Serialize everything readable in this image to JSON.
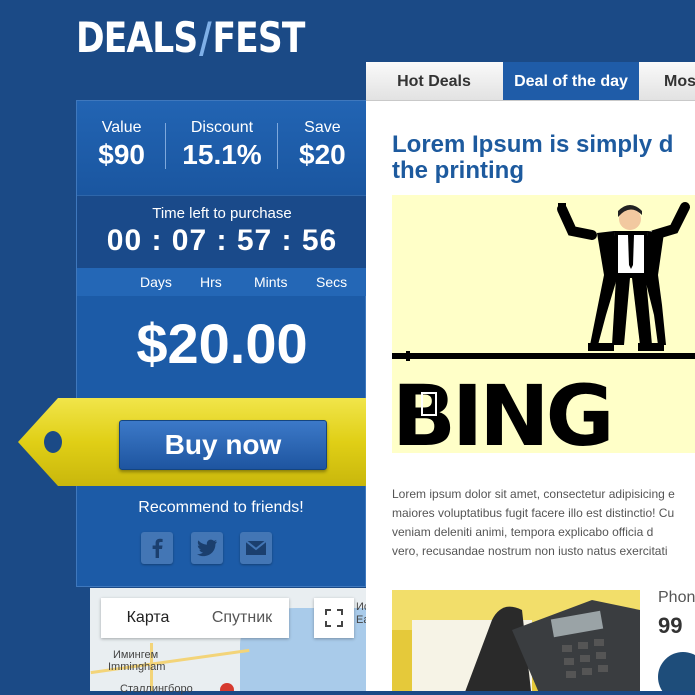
{
  "logo": {
    "part1": "DEALS",
    "slash": "/",
    "part2": "FEST"
  },
  "deal_stats": [
    {
      "label": "Value",
      "value": "$90"
    },
    {
      "label": "Discount",
      "value": "15.1%"
    },
    {
      "label": "Save",
      "value": "$20"
    }
  ],
  "timer": {
    "title": "Time left to purchase",
    "digits": "00 : 07 : 57 : 56",
    "units": [
      "Days",
      "Hrs",
      "Mints",
      "Secs"
    ]
  },
  "price": "$20.00",
  "buy_label": "Buy now",
  "recommend_text": "Recommend to friends!",
  "social": [
    "facebook-icon",
    "twitter-icon",
    "mail-icon"
  ],
  "map": {
    "tab_map": "Карта",
    "tab_satellite": "Спутник",
    "place1": "Имингем",
    "place2": "Immingham",
    "place3": "Сталлингборо",
    "edge1": "Ис",
    "edge2": "Ea"
  },
  "tabs": [
    {
      "label": "Hot Deals"
    },
    {
      "label": "Deal of the day",
      "active": true
    },
    {
      "label": "Mos"
    }
  ],
  "article": {
    "heading_line1": "Lorem Ipsum is simply d",
    "heading_line2": "the printing",
    "bingo_text": "BING",
    "paragraph": [
      "Lorem ipsum dolor sit amet, consectetur adipisicing e",
      "maiores voluptatibus fugit facere illo est distinctio! Cu",
      "veniam deleniti animi, tempora explicabo officia d",
      "vero, recusandae nostrum non iusto natus exercitati"
    ],
    "side_label": "Phon",
    "side_value": "99"
  },
  "colors": {
    "background": "#1b4a86",
    "panel": "#1c5ba7",
    "tag_yellow": "#e2d21d",
    "heading_blue": "#1d5a9e",
    "illustration_bg": "#ffffc8"
  }
}
